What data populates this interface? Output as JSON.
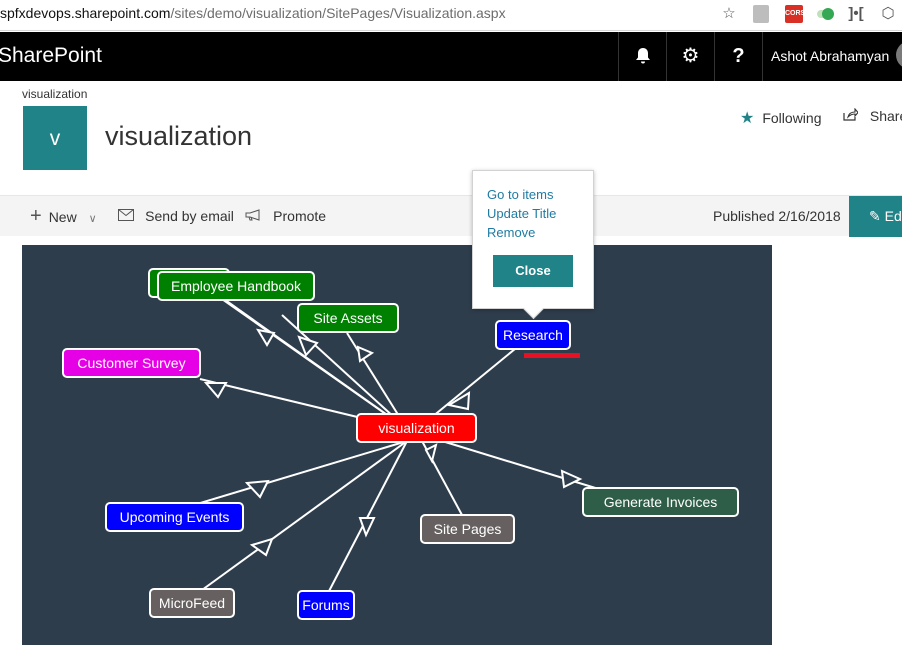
{
  "browser": {
    "url_host": "spfxdevops.sharepoint.com",
    "url_path": "/sites/demo/visualization/SitePages/Visualization.aspx",
    "star_icon": "star-outline-icon",
    "ext_cors_label": "CORS"
  },
  "suite_bar": {
    "brand": "SharePoint",
    "user_name": "Ashot Abrahamyan",
    "bell_icon": "🔔",
    "gear_icon": "⚙",
    "help_icon": "?"
  },
  "site": {
    "breadcrumb": "visualization",
    "logo_letter": "v",
    "title": "visualization",
    "following_label": "Following",
    "share_label": "Share"
  },
  "command_bar": {
    "new_label": "New",
    "send_email_label": "Send by email",
    "promote_label": "Promote",
    "published_label": "Published 2/16/2018",
    "edit_label": "Edit"
  },
  "graph": {
    "center": {
      "label": "visualization",
      "color": "#ff0000"
    },
    "nodes": [
      {
        "id": "employee-handbook",
        "label": "Employee Handbook",
        "color": "#008000"
      },
      {
        "id": "site-assets",
        "label": "Site Assets",
        "color": "#008000"
      },
      {
        "id": "customer-survey",
        "label": "Customer Survey",
        "color": "#e600e6"
      },
      {
        "id": "research",
        "label": "Research",
        "color": "#0000ff"
      },
      {
        "id": "upcoming-events",
        "label": "Upcoming Events",
        "color": "#0000ff"
      },
      {
        "id": "site-pages",
        "label": "Site Pages",
        "color": "#666060"
      },
      {
        "id": "generate-invoices",
        "label": "Generate Invoices",
        "color": "#2e5e47"
      },
      {
        "id": "microfeed",
        "label": "MicroFeed",
        "color": "#666060"
      },
      {
        "id": "forums",
        "label": "Forums",
        "color": "#0000ff"
      }
    ]
  },
  "popup": {
    "go_to_items": "Go to items",
    "update_title": "Update Title",
    "remove": "Remove",
    "close": "Close"
  },
  "colors": {
    "accent": "#1f8387",
    "canvas_bg": "#2e3d4c",
    "link": "#1f7ba2"
  }
}
